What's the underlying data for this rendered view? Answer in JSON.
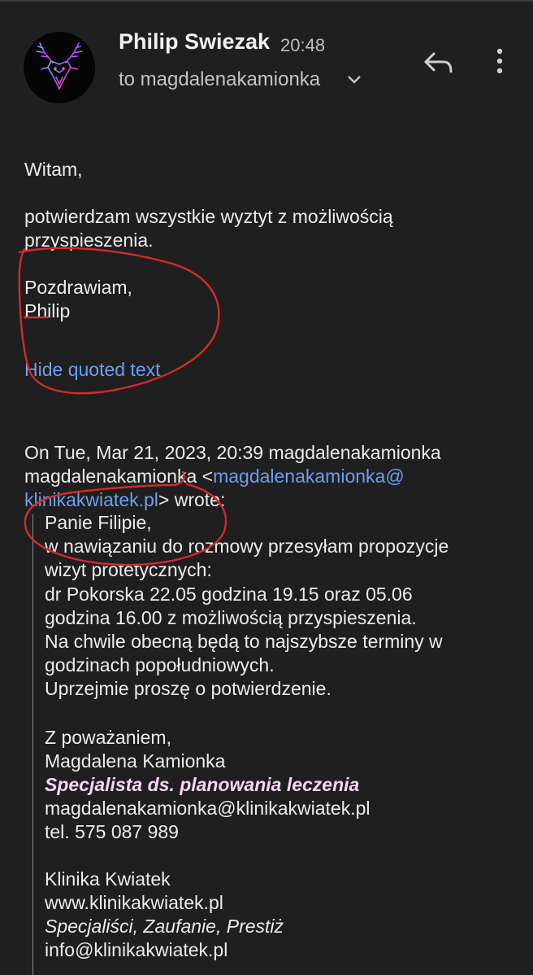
{
  "header": {
    "sender_name": "Philip Swiezak",
    "time": "20:48",
    "recipient": "to magdalenakamionka"
  },
  "message": {
    "greeting": "Witam,",
    "line1": "potwierdzam wszystkie wyztyt z możliwością",
    "line2": "przyspieszenia.",
    "closing": "Pozdrawiam,",
    "signature": "Philip",
    "hide_quoted": "Hide quoted text"
  },
  "quote_header": {
    "line1": "On Tue, Mar 21, 2023, 20:39 magdalenakamionka",
    "line2_prefix": "magdalenakamionka <",
    "email_part1": "magdalenakamionka@",
    "email_part2": "klinikakwiatek.pl",
    "line3_suffix": "> wrote:"
  },
  "quoted": {
    "salutation": "Panie Filipie,",
    "lines": [
      "w nawiązaniu do rozmowy przesyłam propozycje",
      "wizyt protetycznych:",
      "dr Pokorska 22.05 godzina 19.15 oraz 05.06",
      "godzina 16.00 z możliwością przyspieszenia.",
      "Na chwile obecną będą to najszybsze terminy w",
      "godzinach popołudniowych.",
      "Uprzejmie proszę o potwierdzenie."
    ],
    "regards": "Z poważaniem,",
    "name": "Magdalena Kamionka",
    "title": "Specjalista ds. planowania leczenia",
    "email": "magdalenakamionka@klinikakwiatek.pl",
    "phone": "tel.  575 087 989",
    "company": "Klinika Kwiatek",
    "website": "www.klinikakwiatek.pl",
    "motto": "Specjaliści, Zaufanie, Prestiż",
    "info_email": "info@klinikakwiatek.pl"
  },
  "colors": {
    "background": "#1f1f1f",
    "link": "#6e9ef0",
    "annotation": "#d42a2a"
  },
  "icons": {
    "avatar": "deer-head-avatar",
    "expand": "chevron-down-icon",
    "reply": "reply-icon",
    "more": "more-vert-icon"
  }
}
